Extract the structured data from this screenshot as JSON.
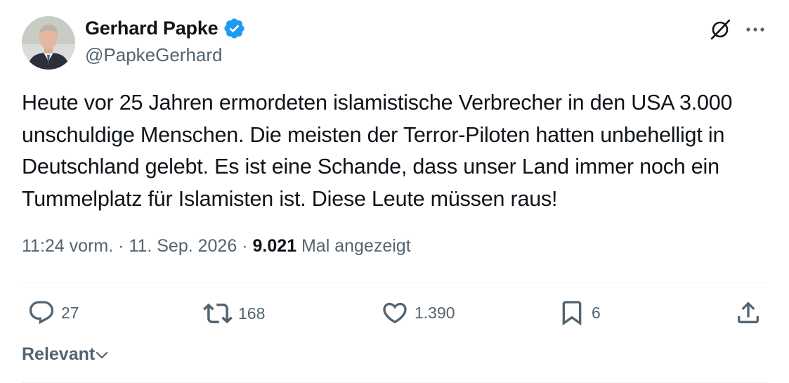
{
  "author": {
    "display_name": "Gerhard Papke",
    "handle": "@PapkeGerhard",
    "verified_color": "#1d9bf0"
  },
  "tweet": {
    "text": "Heute vor 25 Jahren ermordeten islamistische Verbrecher in den USA 3.000 unschuldige Menschen. Die meisten der Terror-Piloten hatten unbehelligt in Deutschland gelebt. Es ist eine Schande, dass unser Land immer noch ein Tummelplatz für Islamisten ist. Diese Leute müssen raus!",
    "time": "11:24 vorm.",
    "separator": "·",
    "date": "11. Sep. 2026",
    "views_count": "9.021",
    "views_label": "Mal angezeigt"
  },
  "actions": {
    "replies": "27",
    "reposts": "168",
    "likes": "1.390",
    "bookmarks": "6"
  },
  "sort": {
    "label": "Relevant"
  },
  "icons": [
    "verified-badge-icon",
    "grok-icon",
    "more-icon",
    "reply-icon",
    "repost-icon",
    "like-icon",
    "bookmark-icon",
    "share-icon",
    "chevron-down-icon"
  ]
}
